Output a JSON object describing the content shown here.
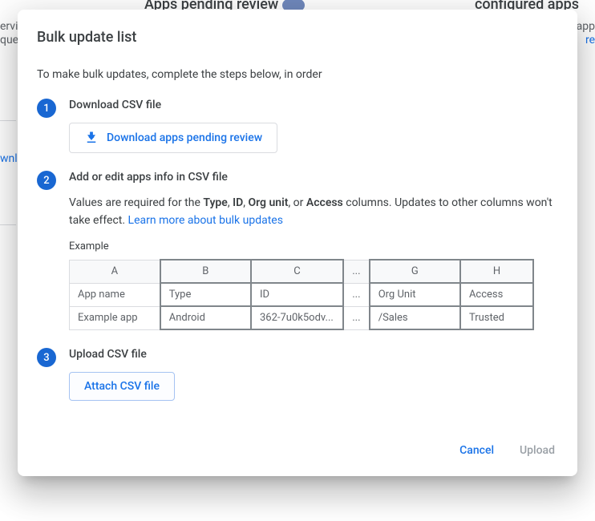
{
  "background": {
    "header_card_title": "Apps pending review",
    "right_card_title": "configured apps",
    "side_text1": "ervic",
    "side_text2": "que",
    "side_link1": "wnl",
    "right_app": "app",
    "right_link": "re"
  },
  "dialog": {
    "title": "Bulk update list",
    "intro": "To make bulk updates, complete the steps below, in order"
  },
  "step1": {
    "num": "1",
    "title": "Download CSV file",
    "button": "Download apps pending review"
  },
  "step2": {
    "num": "2",
    "title": "Add or edit apps info in CSV file",
    "desc_pre": "Values are required for the ",
    "b1": "Type",
    "sep1": ", ",
    "b2": "ID",
    "sep2": ", ",
    "b3": "Org unit",
    "sep3": ", or ",
    "b4": "Access",
    "desc_post": " columns. Updates to other columns won't take effect. ",
    "learn_more": "Learn more about bulk updates",
    "example_label": "Example",
    "table": {
      "headers": {
        "a": "A",
        "b": "B",
        "c": "C",
        "ell": "...",
        "g": "G",
        "h": "H"
      },
      "row1": {
        "a": "App name",
        "b": "Type",
        "c": "ID",
        "ell": "...",
        "g": "Org Unit",
        "h": "Access"
      },
      "row2": {
        "a": "Example app",
        "b": "Android",
        "c": "362-7u0k5odv...",
        "ell": "...",
        "g": "/Sales",
        "h": "Trusted"
      }
    }
  },
  "step3": {
    "num": "3",
    "title": "Upload CSV file",
    "button": "Attach CSV file"
  },
  "actions": {
    "cancel": "Cancel",
    "upload": "Upload"
  }
}
